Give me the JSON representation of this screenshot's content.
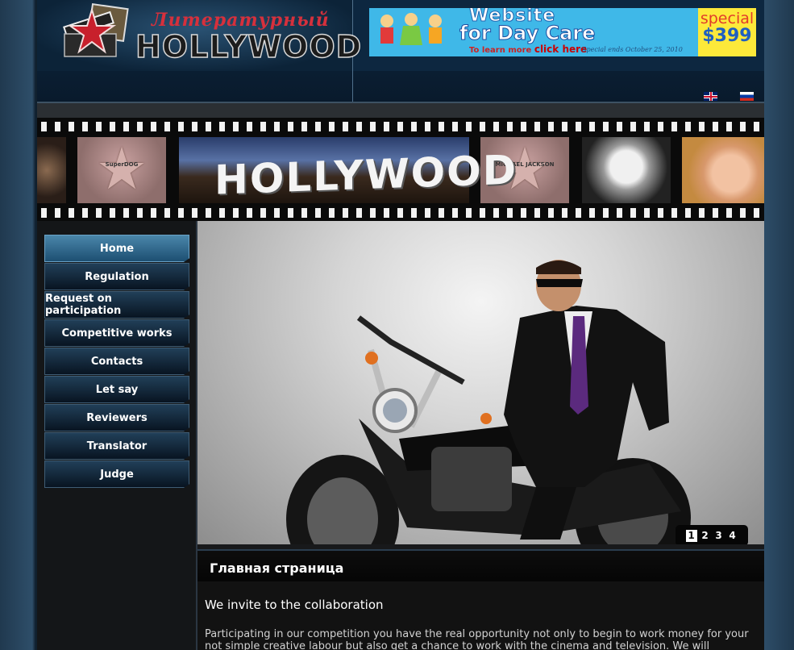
{
  "header": {
    "logo_ru": "Литературный",
    "logo_en": "HOLLYWOOD"
  },
  "ad": {
    "line1": "Website",
    "line2": "for Day Care",
    "learn_more": "To learn more",
    "click_here": "click here",
    "ends": "Special ends October 25, 2010",
    "special": "special",
    "price": "$399"
  },
  "languages": [
    {
      "code": "en",
      "icon": "uk-flag-icon"
    },
    {
      "code": "ru",
      "icon": "russia-flag-icon"
    }
  ],
  "film": {
    "sign_text": "HOLLYWOOD",
    "star1_label": "SuperDOG",
    "star2_label": "MICHAEL JACKSON"
  },
  "nav": [
    {
      "label": "Home",
      "active": true
    },
    {
      "label": "Regulation"
    },
    {
      "label": "Request on participation"
    },
    {
      "label": "Competitive works"
    },
    {
      "label": "Contacts"
    },
    {
      "label": "Let say"
    },
    {
      "label": "Reviewers"
    },
    {
      "label": "Translator"
    },
    {
      "label": "Judge"
    }
  ],
  "slideshow": {
    "pages": [
      "1",
      "2",
      "3",
      "4"
    ],
    "current": "1"
  },
  "content": {
    "title": "Главная страница",
    "intro": "We invite to the collaboration",
    "paragraph": "Participating in our competition you have the real opportunity not only to begin to work money for your not simple creative labour but also get a chance to work with the cinema and television. We will"
  },
  "colors": {
    "nav_active": "#3a7aa2",
    "nav_bg": "#0e2236",
    "page_bg": "#18191b"
  }
}
